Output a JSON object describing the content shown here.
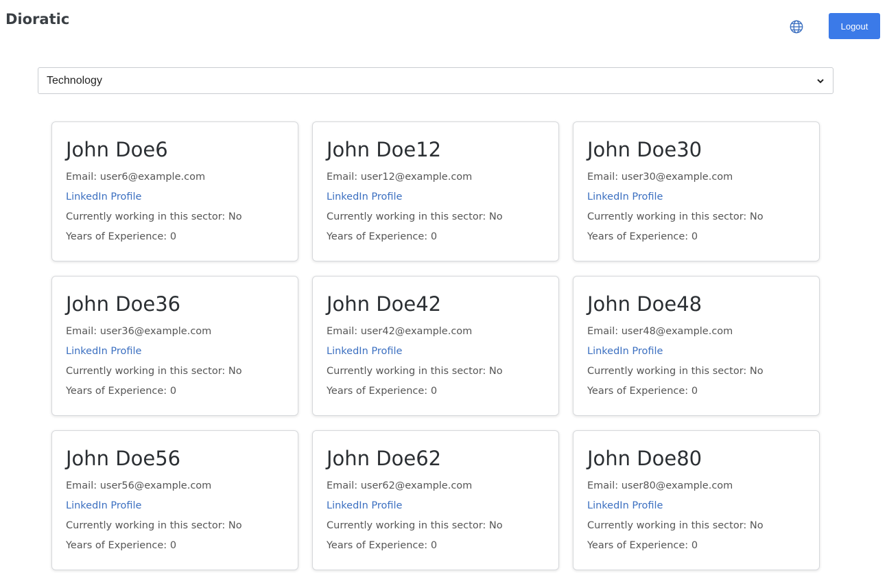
{
  "header": {
    "brand": "Dioratic",
    "language_icon": "globe-icon",
    "logout_label": "Logout",
    "accent_color": "#3b7ae8"
  },
  "filter": {
    "selected_sector": "Technology"
  },
  "labels": {
    "email_prefix": "Email: ",
    "linkedin": "LinkedIn Profile",
    "working_prefix": "Currently working in this sector: ",
    "experience_prefix": "Years of Experience: "
  },
  "people": [
    {
      "name": "John Doe6",
      "email": "user6@example.com",
      "working": "No",
      "experience": "0"
    },
    {
      "name": "John Doe12",
      "email": "user12@example.com",
      "working": "No",
      "experience": "0"
    },
    {
      "name": "John Doe30",
      "email": "user30@example.com",
      "working": "No",
      "experience": "0"
    },
    {
      "name": "John Doe36",
      "email": "user36@example.com",
      "working": "No",
      "experience": "0"
    },
    {
      "name": "John Doe42",
      "email": "user42@example.com",
      "working": "No",
      "experience": "0"
    },
    {
      "name": "John Doe48",
      "email": "user48@example.com",
      "working": "No",
      "experience": "0"
    },
    {
      "name": "John Doe56",
      "email": "user56@example.com",
      "working": "No",
      "experience": "0"
    },
    {
      "name": "John Doe62",
      "email": "user62@example.com",
      "working": "No",
      "experience": "0"
    },
    {
      "name": "John Doe80",
      "email": "user80@example.com",
      "working": "No",
      "experience": "0"
    }
  ]
}
